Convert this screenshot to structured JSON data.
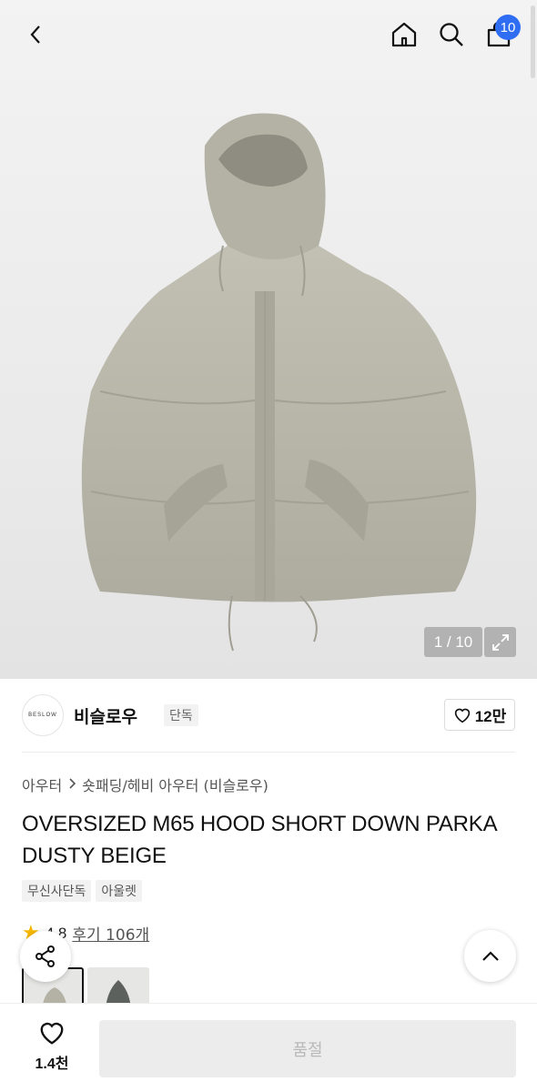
{
  "nav": {
    "back_icon": "chevron-left-icon",
    "home_icon": "home-icon",
    "search_icon": "search-icon",
    "cart_icon": "shopping-bag-icon",
    "cart_count": "10"
  },
  "gallery": {
    "counter": "1 / 10",
    "expand_icon": "expand-icon"
  },
  "brand": {
    "logo_text": "BESLOW",
    "name": "비슬로우",
    "tag": "단독",
    "like_icon": "heart-icon",
    "like_count": "12만"
  },
  "breadcrumb": {
    "category": "아우터",
    "subcategory": "숏패딩/헤비 아우터 (비슬로우)"
  },
  "product": {
    "title": "OVERSIZED M65 HOOD SHORT DOWN PARKA DUSTY BEIGE",
    "tags": [
      "무신사단독",
      "아울렛"
    ],
    "rating": "4.8",
    "reviews": "후기 106개"
  },
  "floating": {
    "share_icon": "share-icon",
    "top_icon": "chevron-up-icon"
  },
  "bottom": {
    "wish_icon": "heart-icon",
    "wish_count": "1.4천",
    "buy_label": "품절"
  },
  "colors": {
    "accent": "#2f6df3",
    "star": "#f5b700",
    "jacket": "#b9b7a9"
  }
}
